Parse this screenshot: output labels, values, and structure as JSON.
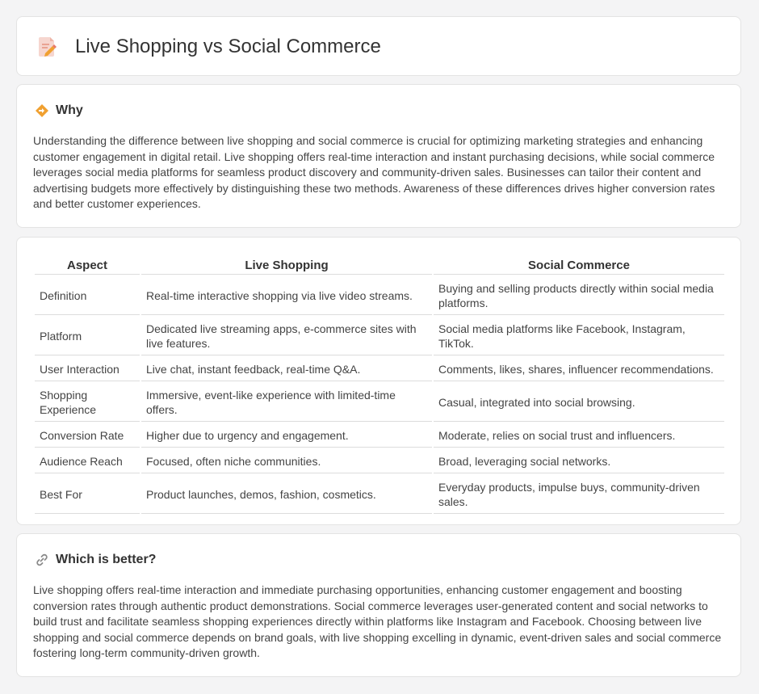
{
  "header": {
    "title": "Live Shopping vs Social Commerce",
    "icon": "document-pencil-icon"
  },
  "why": {
    "icon": "diamond-sign-icon",
    "title": "Why",
    "text": "Understanding the difference between live shopping and social commerce is crucial for optimizing marketing strategies and enhancing customer engagement in digital retail. Live shopping offers real-time interaction and instant purchasing decisions, while social commerce leverages social media platforms for seamless product discovery and community-driven sales. Businesses can tailor their content and advertising budgets more effectively by distinguishing these two methods. Awareness of these differences drives higher conversion rates and better customer experiences."
  },
  "table": {
    "headers": [
      "Aspect",
      "Live Shopping",
      "Social Commerce"
    ],
    "rows": [
      [
        "Definition",
        "Real-time interactive shopping via live video streams.",
        "Buying and selling products directly within social media platforms."
      ],
      [
        "Platform",
        "Dedicated live streaming apps, e-commerce sites with live features.",
        "Social media platforms like Facebook, Instagram, TikTok."
      ],
      [
        "User Interaction",
        "Live chat, instant feedback, real-time Q&A.",
        "Comments, likes, shares, influencer recommendations."
      ],
      [
        "Shopping Experience",
        "Immersive, event-like experience with limited-time offers.",
        "Casual, integrated into social browsing."
      ],
      [
        "Conversion Rate",
        "Higher due to urgency and engagement.",
        "Moderate, relies on social trust and influencers."
      ],
      [
        "Audience Reach",
        "Focused, often niche communities.",
        "Broad, leveraging social networks."
      ],
      [
        "Best For",
        "Product launches, demos, fashion, cosmetics.",
        "Everyday products, impulse buys, community-driven sales."
      ]
    ]
  },
  "better": {
    "icon": "link-icon",
    "title": "Which is better?",
    "text": "Live shopping offers real-time interaction and immediate purchasing opportunities, enhancing customer engagement and boosting conversion rates through authentic product demonstrations. Social commerce leverages user-generated content and social networks to build trust and facilitate seamless shopping experiences directly within platforms like Instagram and Facebook. Choosing between live shopping and social commerce depends on brand goals, with live shopping excelling in dynamic, event-driven sales and social commerce fostering long-term community-driven growth."
  },
  "colors": {
    "background": "#f4f4f5",
    "card": "#ffffff",
    "border": "#e3e3e3",
    "accent_orange": "#f0a030",
    "icon_pink": "#e87a6a"
  }
}
